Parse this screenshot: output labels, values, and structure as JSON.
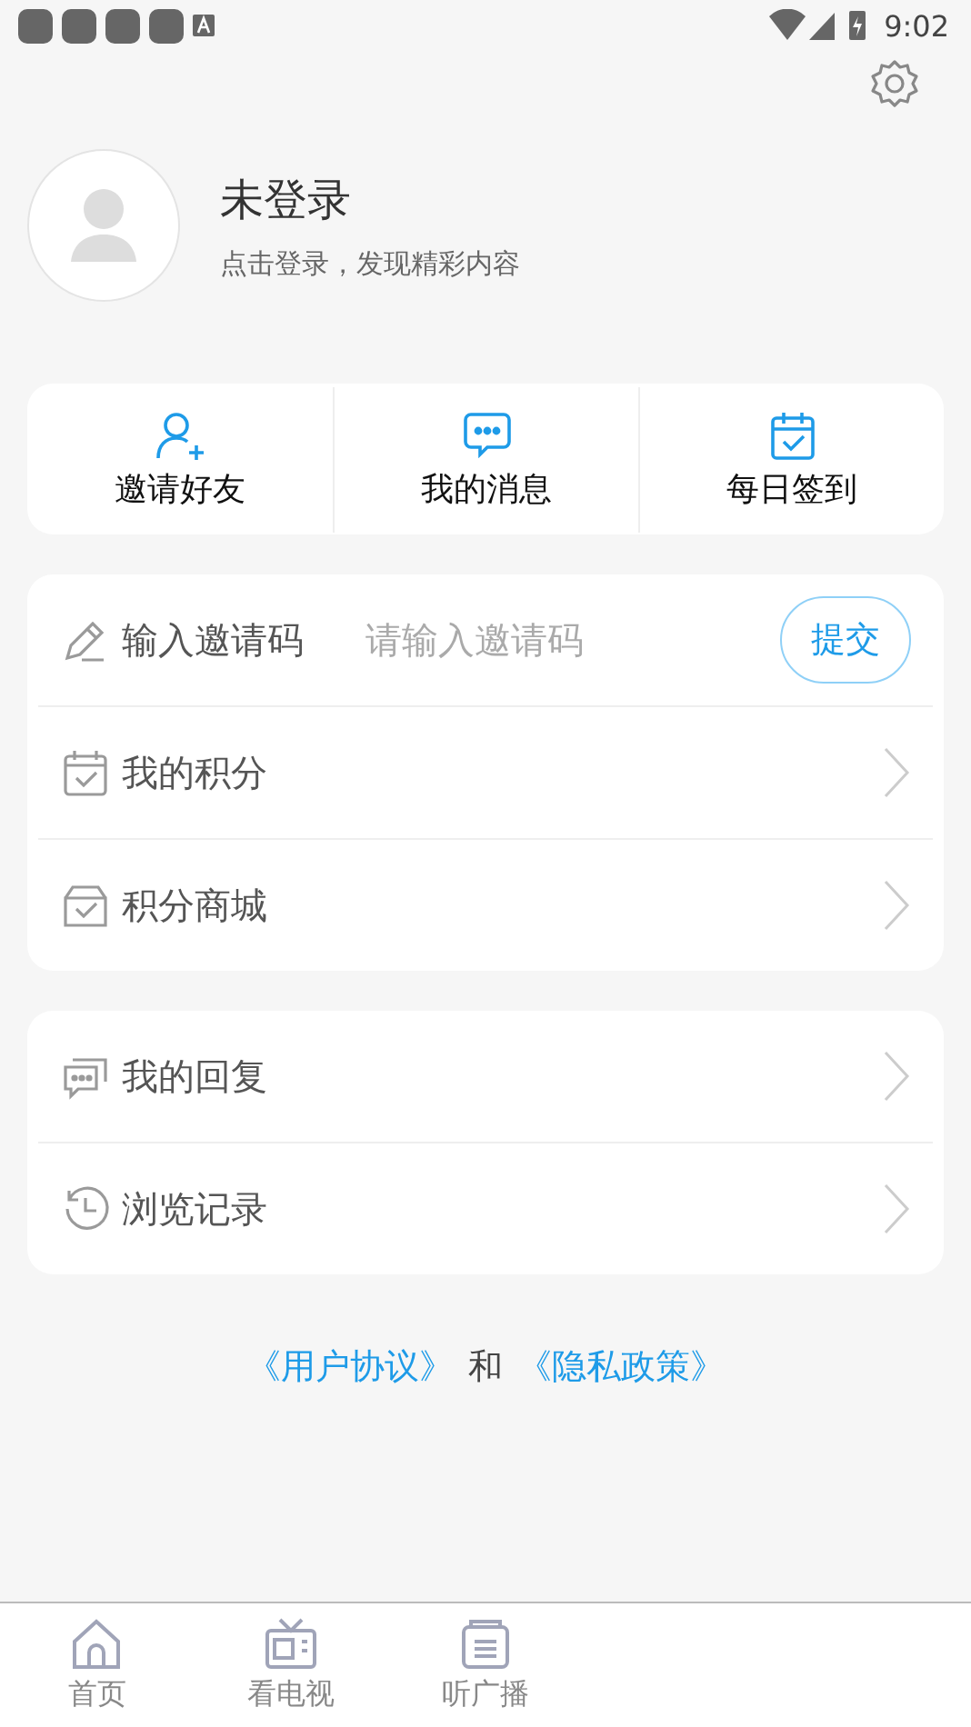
{
  "status_bar": {
    "time": "9:02"
  },
  "profile": {
    "name": "未登录",
    "hint": "点击登录，发现精彩内容"
  },
  "quick_actions": [
    {
      "kind": "invite",
      "label": "邀请好友"
    },
    {
      "kind": "message",
      "label": "我的消息"
    },
    {
      "kind": "checkin",
      "label": "每日签到"
    }
  ],
  "invite_code": {
    "label": "输入邀请码",
    "placeholder": "请输入邀请码",
    "button": "提交"
  },
  "menu_groups": [
    [
      {
        "kind": "points",
        "label": "我的积分"
      },
      {
        "kind": "mall",
        "label": "积分商城"
      }
    ],
    [
      {
        "kind": "replies",
        "label": "我的回复"
      },
      {
        "kind": "history",
        "label": "浏览记录"
      }
    ]
  ],
  "footer": {
    "links": [
      "《用户协议》",
      "《隐私政策》"
    ],
    "conjunction": "和"
  },
  "tab_bar": [
    {
      "kind": "home",
      "label": "首页"
    },
    {
      "kind": "tv",
      "label": "看电视"
    },
    {
      "kind": "radio",
      "label": "听广播"
    }
  ]
}
